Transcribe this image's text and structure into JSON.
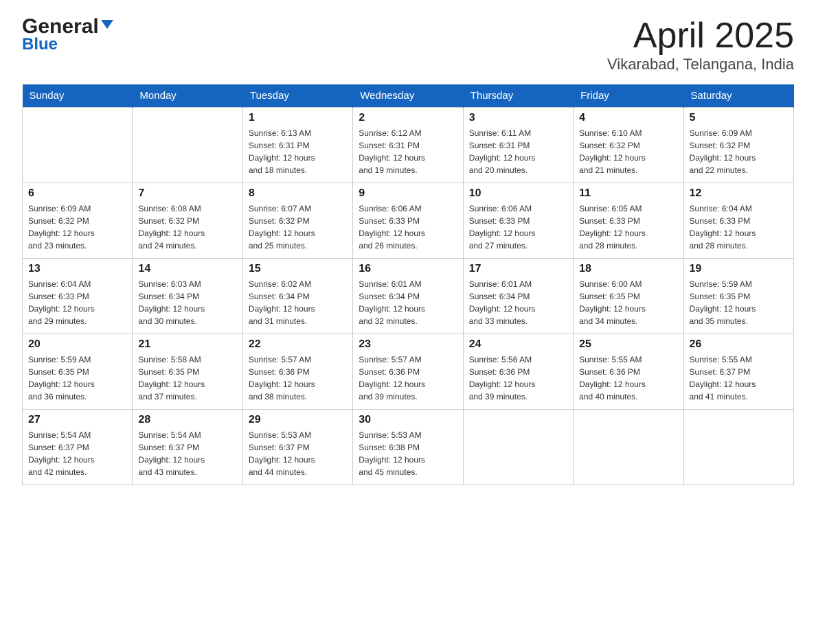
{
  "header": {
    "title": "April 2025",
    "subtitle": "Vikarabad, Telangana, India",
    "logo_line1": "General",
    "logo_arrow": "▼",
    "logo_line2": "Blue"
  },
  "days_of_week": [
    "Sunday",
    "Monday",
    "Tuesday",
    "Wednesday",
    "Thursday",
    "Friday",
    "Saturday"
  ],
  "weeks": [
    [
      {
        "day": "",
        "info": ""
      },
      {
        "day": "",
        "info": ""
      },
      {
        "day": "1",
        "info": "Sunrise: 6:13 AM\nSunset: 6:31 PM\nDaylight: 12 hours\nand 18 minutes."
      },
      {
        "day": "2",
        "info": "Sunrise: 6:12 AM\nSunset: 6:31 PM\nDaylight: 12 hours\nand 19 minutes."
      },
      {
        "day": "3",
        "info": "Sunrise: 6:11 AM\nSunset: 6:31 PM\nDaylight: 12 hours\nand 20 minutes."
      },
      {
        "day": "4",
        "info": "Sunrise: 6:10 AM\nSunset: 6:32 PM\nDaylight: 12 hours\nand 21 minutes."
      },
      {
        "day": "5",
        "info": "Sunrise: 6:09 AM\nSunset: 6:32 PM\nDaylight: 12 hours\nand 22 minutes."
      }
    ],
    [
      {
        "day": "6",
        "info": "Sunrise: 6:09 AM\nSunset: 6:32 PM\nDaylight: 12 hours\nand 23 minutes."
      },
      {
        "day": "7",
        "info": "Sunrise: 6:08 AM\nSunset: 6:32 PM\nDaylight: 12 hours\nand 24 minutes."
      },
      {
        "day": "8",
        "info": "Sunrise: 6:07 AM\nSunset: 6:32 PM\nDaylight: 12 hours\nand 25 minutes."
      },
      {
        "day": "9",
        "info": "Sunrise: 6:06 AM\nSunset: 6:33 PM\nDaylight: 12 hours\nand 26 minutes."
      },
      {
        "day": "10",
        "info": "Sunrise: 6:06 AM\nSunset: 6:33 PM\nDaylight: 12 hours\nand 27 minutes."
      },
      {
        "day": "11",
        "info": "Sunrise: 6:05 AM\nSunset: 6:33 PM\nDaylight: 12 hours\nand 28 minutes."
      },
      {
        "day": "12",
        "info": "Sunrise: 6:04 AM\nSunset: 6:33 PM\nDaylight: 12 hours\nand 28 minutes."
      }
    ],
    [
      {
        "day": "13",
        "info": "Sunrise: 6:04 AM\nSunset: 6:33 PM\nDaylight: 12 hours\nand 29 minutes."
      },
      {
        "day": "14",
        "info": "Sunrise: 6:03 AM\nSunset: 6:34 PM\nDaylight: 12 hours\nand 30 minutes."
      },
      {
        "day": "15",
        "info": "Sunrise: 6:02 AM\nSunset: 6:34 PM\nDaylight: 12 hours\nand 31 minutes."
      },
      {
        "day": "16",
        "info": "Sunrise: 6:01 AM\nSunset: 6:34 PM\nDaylight: 12 hours\nand 32 minutes."
      },
      {
        "day": "17",
        "info": "Sunrise: 6:01 AM\nSunset: 6:34 PM\nDaylight: 12 hours\nand 33 minutes."
      },
      {
        "day": "18",
        "info": "Sunrise: 6:00 AM\nSunset: 6:35 PM\nDaylight: 12 hours\nand 34 minutes."
      },
      {
        "day": "19",
        "info": "Sunrise: 5:59 AM\nSunset: 6:35 PM\nDaylight: 12 hours\nand 35 minutes."
      }
    ],
    [
      {
        "day": "20",
        "info": "Sunrise: 5:59 AM\nSunset: 6:35 PM\nDaylight: 12 hours\nand 36 minutes."
      },
      {
        "day": "21",
        "info": "Sunrise: 5:58 AM\nSunset: 6:35 PM\nDaylight: 12 hours\nand 37 minutes."
      },
      {
        "day": "22",
        "info": "Sunrise: 5:57 AM\nSunset: 6:36 PM\nDaylight: 12 hours\nand 38 minutes."
      },
      {
        "day": "23",
        "info": "Sunrise: 5:57 AM\nSunset: 6:36 PM\nDaylight: 12 hours\nand 39 minutes."
      },
      {
        "day": "24",
        "info": "Sunrise: 5:56 AM\nSunset: 6:36 PM\nDaylight: 12 hours\nand 39 minutes."
      },
      {
        "day": "25",
        "info": "Sunrise: 5:55 AM\nSunset: 6:36 PM\nDaylight: 12 hours\nand 40 minutes."
      },
      {
        "day": "26",
        "info": "Sunrise: 5:55 AM\nSunset: 6:37 PM\nDaylight: 12 hours\nand 41 minutes."
      }
    ],
    [
      {
        "day": "27",
        "info": "Sunrise: 5:54 AM\nSunset: 6:37 PM\nDaylight: 12 hours\nand 42 minutes."
      },
      {
        "day": "28",
        "info": "Sunrise: 5:54 AM\nSunset: 6:37 PM\nDaylight: 12 hours\nand 43 minutes."
      },
      {
        "day": "29",
        "info": "Sunrise: 5:53 AM\nSunset: 6:37 PM\nDaylight: 12 hours\nand 44 minutes."
      },
      {
        "day": "30",
        "info": "Sunrise: 5:53 AM\nSunset: 6:38 PM\nDaylight: 12 hours\nand 45 minutes."
      },
      {
        "day": "",
        "info": ""
      },
      {
        "day": "",
        "info": ""
      },
      {
        "day": "",
        "info": ""
      }
    ]
  ]
}
